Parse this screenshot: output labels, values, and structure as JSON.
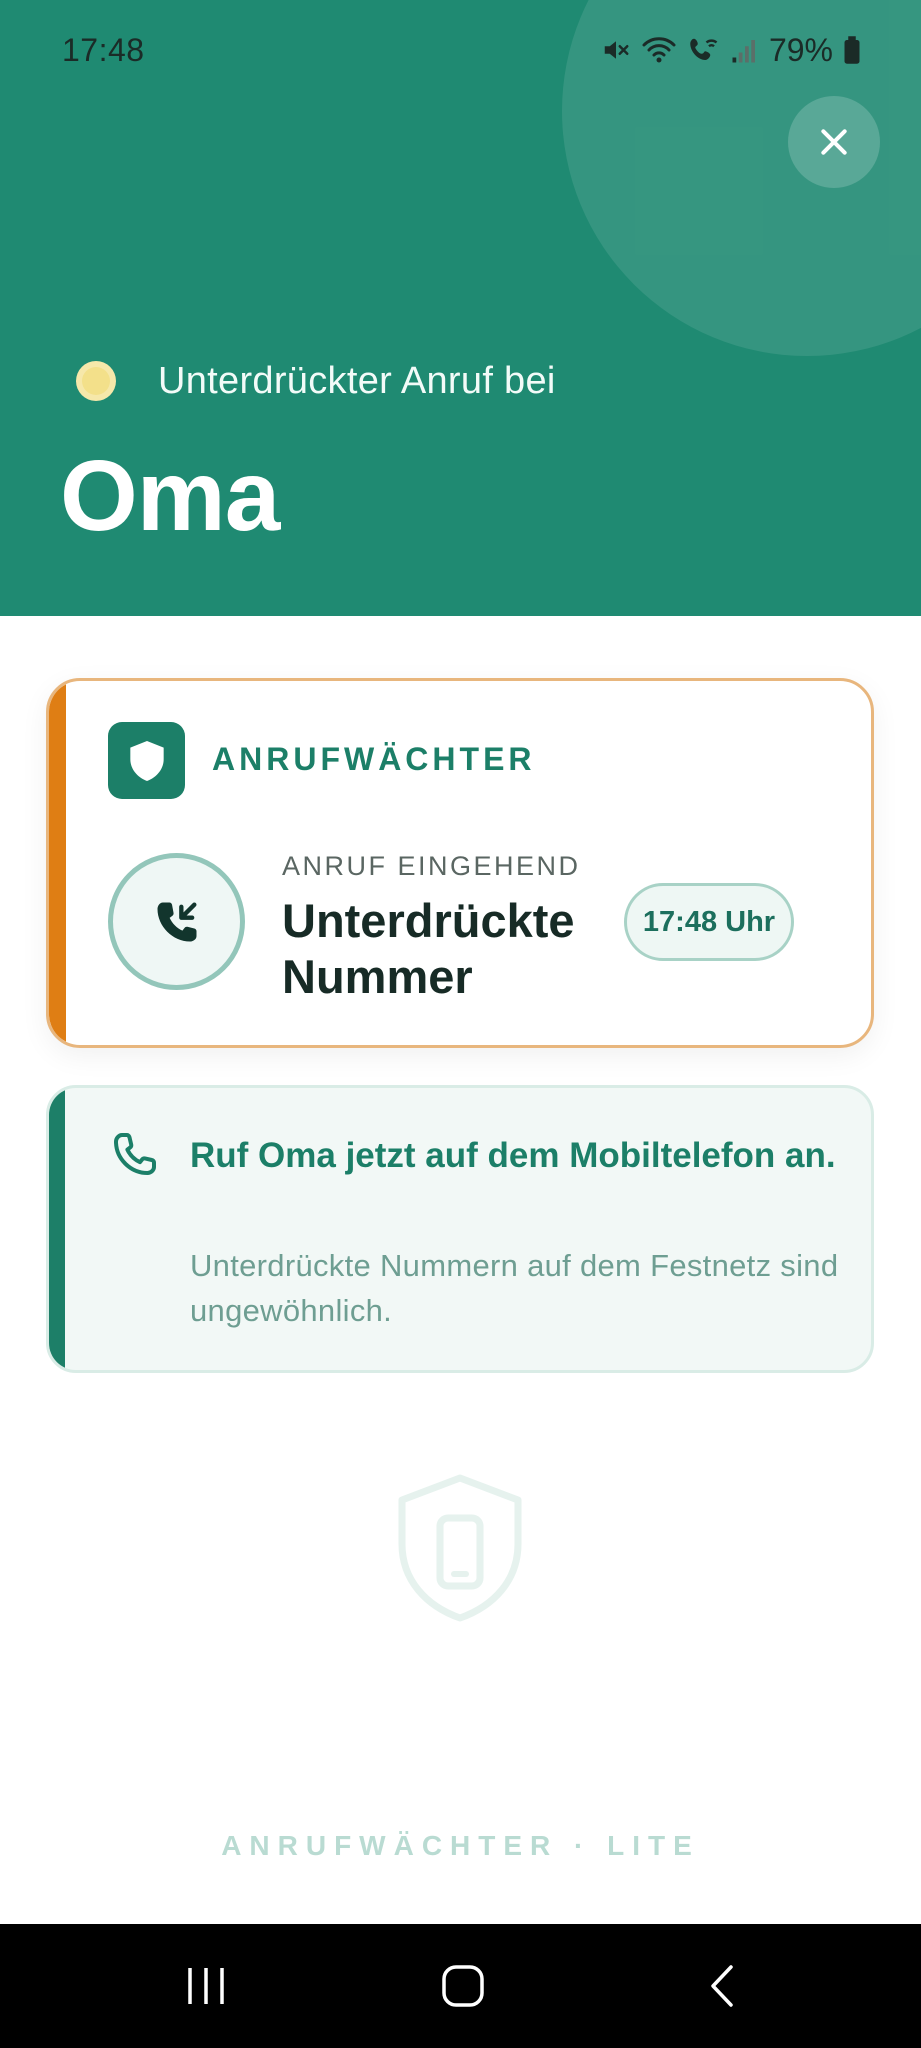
{
  "status_bar": {
    "time": "17:48",
    "battery": "79%",
    "icons": [
      "mute-icon",
      "wifi-icon",
      "wifi-calling-icon",
      "signal-icon",
      "battery-icon"
    ]
  },
  "header": {
    "close_icon": "close-icon",
    "status_dot_color": "#f3e08a",
    "subtitle": "Unterdrückter Anruf bei",
    "caller_name": "Oma",
    "background_color": "#1f8a72"
  },
  "alert_card": {
    "brand_icon": "shield-icon",
    "brand_label": "ANRUFWÄCHTER",
    "call_icon": "phone-incoming-icon",
    "direction_label": "ANRUF EINGEHEND",
    "number_label": "Unterdrückte Nummer",
    "time_label": "17:48 Uhr",
    "accent_color": "#df7e14"
  },
  "advice_card": {
    "icon": "phone-icon",
    "title": "Ruf Oma jetzt auf dem Mobiltelefon an.",
    "text": "Unterdrückte Nummern auf dem Festnetz sind ungewöhnlich.",
    "accent_color": "#1d7f68"
  },
  "watermark_icon": "shield-phone-icon",
  "footer": {
    "brand": "ANRUFWÄCHTER · LITE"
  },
  "nav_bar": {
    "recents_icon": "recents-icon",
    "home_icon": "home-icon",
    "back_icon": "back-icon"
  }
}
